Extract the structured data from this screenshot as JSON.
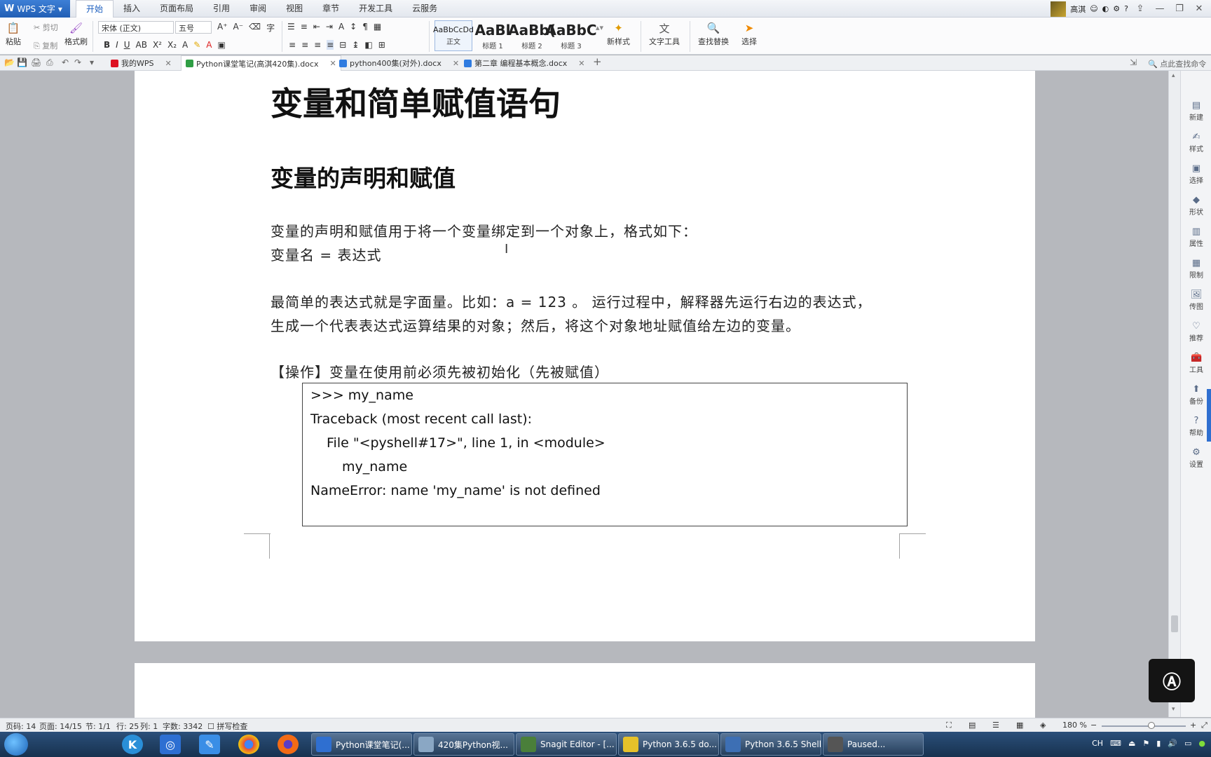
{
  "app": {
    "name": "WPS 文字"
  },
  "menu": {
    "tabs": [
      "开始",
      "插入",
      "页面布局",
      "引用",
      "审阅",
      "视图",
      "章节",
      "开发工具",
      "云服务"
    ],
    "active_index": 0
  },
  "user": {
    "name": "高淇"
  },
  "ribbon": {
    "paste": "粘贴",
    "cut": "剪切",
    "copy": "复制",
    "format_painter": "格式刷",
    "font_name": "宋体 (正文)",
    "font_size": "五号",
    "styles": [
      {
        "preview": "AaBbCcDd",
        "label": "正文"
      },
      {
        "preview": "AaBl",
        "label": "标题 1"
      },
      {
        "preview": "AaBb(",
        "label": "标题 2"
      },
      {
        "preview": "AaBbC",
        "label": "标题 3"
      }
    ],
    "new_style": "新样式",
    "text_tools": "文字工具",
    "find_replace": "查找替换",
    "select": "选择"
  },
  "doc_tabs": [
    {
      "label": "我的WPS"
    },
    {
      "label": "Python课堂笔记(高淇420集).docx"
    },
    {
      "label": "python400集(对外).docx"
    },
    {
      "label": "第二章 编程基本概念.docx"
    }
  ],
  "command_search": "点此查找命令",
  "document": {
    "title": "变量和简单赋值语句",
    "heading2": "变量的声明和赋值",
    "para1_line1": "变量的声明和赋值用于将一个变量绑定到一个对象上，格式如下：",
    "para1_line2": "变量名 = 表达式",
    "para2_line1": "最简单的表达式就是字面量。比如：a = 123 。 运行过程中，解释器先运行右边的表达式，",
    "para2_line2": "生成一个代表表达式运算结果的对象；然后，将这个对象地址赋值给左边的变量。",
    "operation": "【操作】变量在使用前必须先被初始化（先被赋值）",
    "code_lines": [
      ">>> my_name",
      "Traceback (most recent call last):",
      "  File \"<pyshell#17>\", line 1, in <module>",
      "    my_name",
      "NameError: name 'my_name' is not defined"
    ]
  },
  "side_panel": [
    "新建",
    "样式",
    "选择",
    "形状",
    "属性",
    "限制",
    "传图",
    "推荐",
    "工具",
    "备份",
    "帮助",
    "设置"
  ],
  "status": {
    "page_code": "页码: 14",
    "pages": "页面: 14/15",
    "section": "节: 1/1",
    "row": "行: 25",
    "col": "列: 1",
    "word_count": "字数: 3342",
    "spell_check": "拼写检查",
    "zoom": "180 %"
  },
  "taskbar": {
    "tasks": [
      "Python课堂笔记(...",
      "420集Python视...",
      "Snagit Editor - [...",
      "Python 3.6.5 do...",
      "Python 3.6.5 Shell",
      "Paused..."
    ],
    "tray_lang": "CH"
  }
}
